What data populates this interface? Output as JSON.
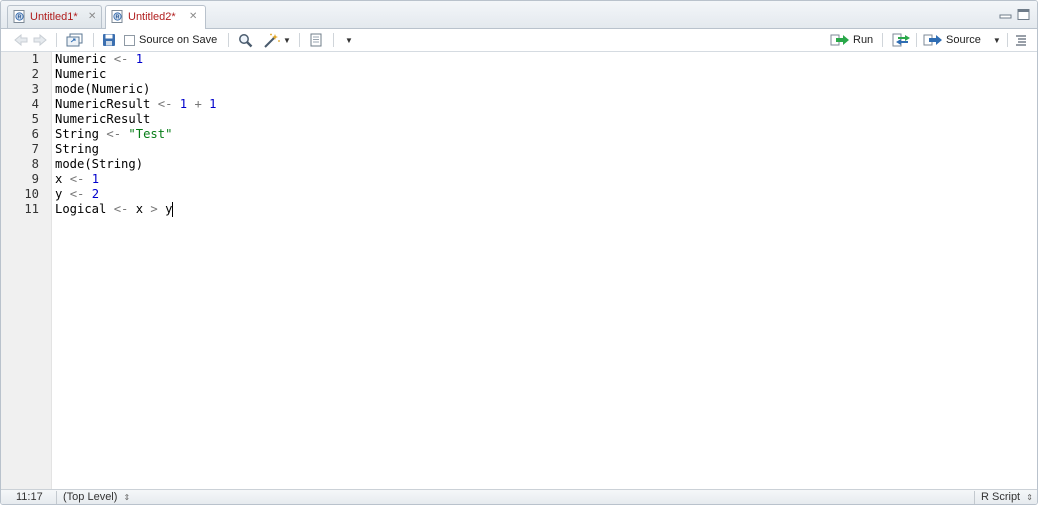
{
  "tabs": [
    {
      "label": "Untitled1*",
      "active": false
    },
    {
      "label": "Untitled2*",
      "active": true
    }
  ],
  "toolbar": {
    "source_on_save_label": "Source on Save",
    "source_on_save_checked": false,
    "run_label": "Run",
    "source_label": "Source"
  },
  "editor": {
    "lines": [
      [
        [
          "Numeric ",
          ""
        ],
        [
          "<-",
          "op"
        ],
        [
          " ",
          ""
        ],
        [
          "1",
          "num"
        ]
      ],
      [
        [
          "Numeric",
          ""
        ]
      ],
      [
        [
          "mode(Numeric)",
          ""
        ]
      ],
      [
        [
          "NumericResult ",
          ""
        ],
        [
          "<-",
          "op"
        ],
        [
          " ",
          ""
        ],
        [
          "1",
          "num"
        ],
        [
          " ",
          ""
        ],
        [
          "+",
          "op"
        ],
        [
          " ",
          ""
        ],
        [
          "1",
          "num"
        ]
      ],
      [
        [
          "NumericResult",
          ""
        ]
      ],
      [
        [
          "String ",
          ""
        ],
        [
          "<-",
          "op"
        ],
        [
          " ",
          ""
        ],
        [
          "\"Test\"",
          "str"
        ]
      ],
      [
        [
          "String",
          ""
        ]
      ],
      [
        [
          "mode(String)",
          ""
        ]
      ],
      [
        [
          "x ",
          ""
        ],
        [
          "<-",
          "op"
        ],
        [
          " ",
          ""
        ],
        [
          "1",
          "num"
        ]
      ],
      [
        [
          "y ",
          ""
        ],
        [
          "<-",
          "op"
        ],
        [
          " ",
          ""
        ],
        [
          "2",
          "num"
        ]
      ],
      [
        [
          "Logical ",
          ""
        ],
        [
          "<-",
          "op"
        ],
        [
          " x ",
          ""
        ],
        [
          ">",
          "op"
        ],
        [
          " y",
          ""
        ]
      ]
    ],
    "line_numbers": [
      "1",
      "2",
      "3",
      "4",
      "5",
      "6",
      "7",
      "8",
      "9",
      "10",
      "11"
    ]
  },
  "status": {
    "position": "11:17",
    "scope": "(Top Level)",
    "file_type": "R Script"
  },
  "colors": {
    "tab_text": "#b01d1d",
    "number": "#0000cc",
    "string": "#067d17",
    "operator": "#777777"
  }
}
